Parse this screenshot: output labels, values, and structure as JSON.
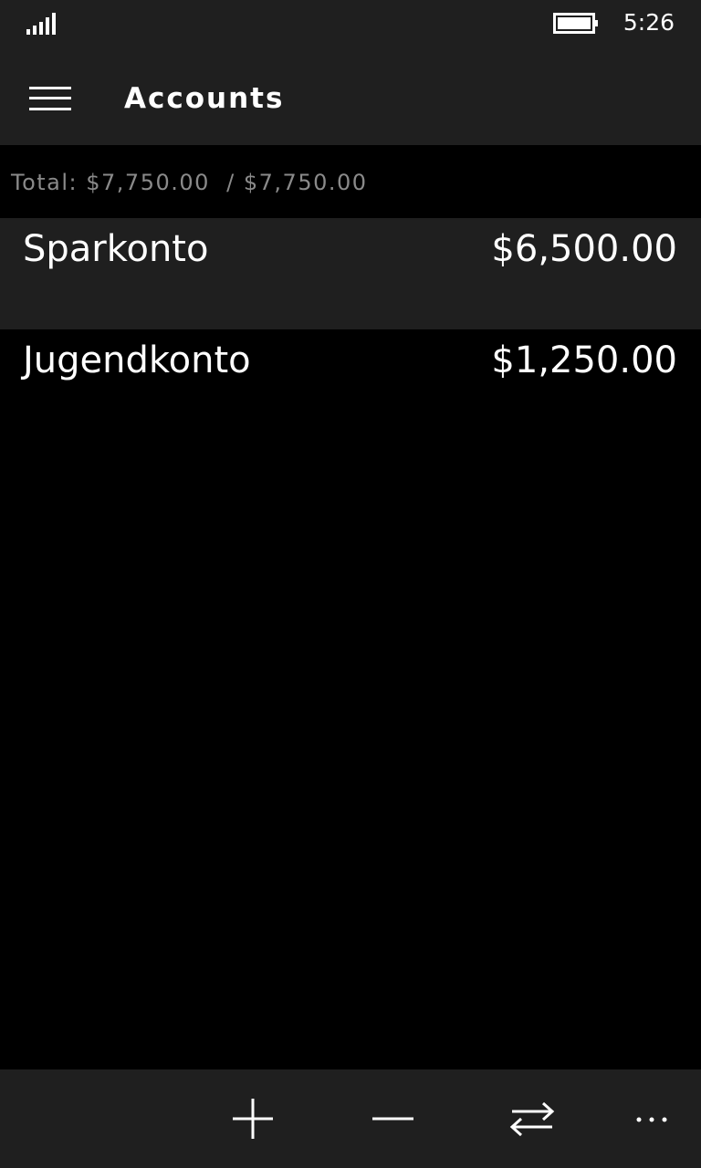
{
  "status_bar": {
    "time": "5:26",
    "signal_icon": "signal-strength-icon",
    "battery_icon": "battery-icon"
  },
  "header": {
    "title": "Accounts",
    "menu_icon": "hamburger-menu-icon"
  },
  "summary": {
    "total_text": "Total: $7,750.00  / $7,750.00"
  },
  "accounts": [
    {
      "name": "Sparkonto",
      "balance": "$6,500.00",
      "selected": true
    },
    {
      "name": "Jugendkonto",
      "balance": "$1,250.00",
      "selected": false
    }
  ],
  "app_bar": {
    "buttons": [
      {
        "icon": "add-icon"
      },
      {
        "icon": "remove-icon"
      },
      {
        "icon": "transfer-icon"
      },
      {
        "icon": "more-icon"
      }
    ]
  },
  "colors": {
    "background": "#000000",
    "chrome": "#1f1f1f",
    "text": "#ffffff",
    "secondary_text": "#8a8a8a"
  }
}
